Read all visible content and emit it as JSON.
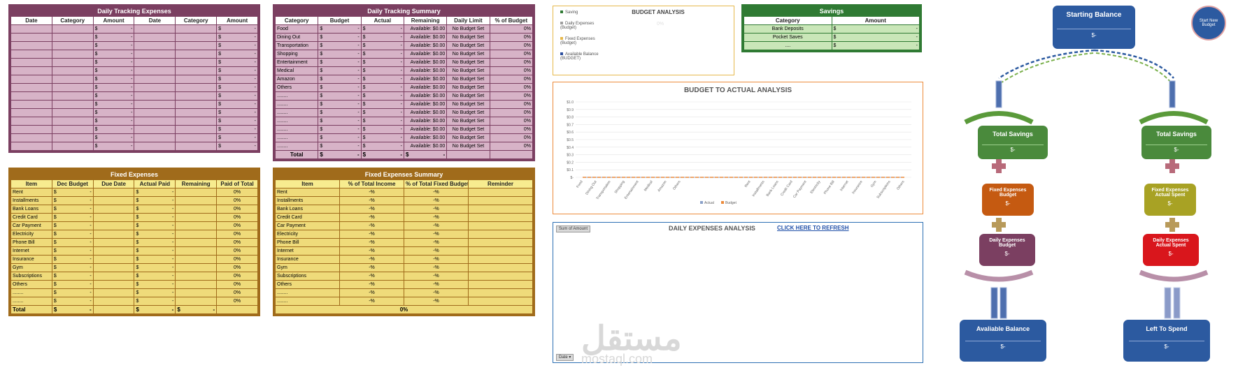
{
  "daily_tracking_expenses": {
    "title": "Daily Tracking Expenses",
    "headers": [
      "Date",
      "Category",
      "Amount",
      "Date",
      "Category",
      "Amount"
    ],
    "currency": "$",
    "dash": "-",
    "row_count": 15
  },
  "daily_tracking_summary": {
    "title": "Daily Tracking Summary",
    "headers": [
      "Category",
      "Budget",
      "Actual",
      "Remaining",
      "Daily Limit",
      "% of Budget"
    ],
    "rows": [
      "Food",
      "Dining Out",
      "Transportation",
      "Shopping",
      "Entertainment",
      "Medical",
      "Amazon",
      "Others",
      "........",
      "........",
      "........",
      "........",
      "........",
      "........",
      "........"
    ],
    "remaining_text": "Available: $0.00",
    "daily_limit_text": "No Budget Set",
    "pct_text": "0%",
    "total_label": "Total"
  },
  "fixed_expenses": {
    "title": "Fixed Expenses",
    "headers": [
      "Item",
      "Dec Budget",
      "Due Date",
      "Actual Paid",
      "Remaining",
      "Paid of Total"
    ],
    "rows": [
      "Rent",
      "Installments",
      "Bank Loans",
      "Credit Card",
      "Car Payment",
      "Electricity",
      "Phone Bill",
      "Internet",
      "Insurance",
      "Gym",
      "Subscriptions",
      "Others",
      "........",
      "........"
    ],
    "pct": "0%",
    "total_label": "Total"
  },
  "fixed_expenses_summary": {
    "title": "Fixed Expenses Summary",
    "headers": [
      "Item",
      "% of Total Income",
      "% of Total Fixed Budget",
      "Reminder"
    ],
    "rows": [
      "Rent",
      "Installments",
      "Bank Loans",
      "Credit Card",
      "Car Payment",
      "Electricity",
      "Phone Bill",
      "Internet",
      "Insurance",
      "Gym",
      "Subscriptions",
      "Others",
      "........",
      "........"
    ],
    "pct_placeholder": "-%",
    "total_pct": "0%"
  },
  "budget_analysis": {
    "title": "BUDGET ANALYSIS",
    "center_value": "0%",
    "legend": [
      {
        "label": "Saving",
        "color": "#2f7a33"
      },
      {
        "label": "Daily Expenses (Budget)",
        "color": "#9e9e9e"
      },
      {
        "label": "Fixed Expenses (Budget)",
        "color": "#e6b84a"
      },
      {
        "label": "Available Balance (BUDGET)",
        "color": "#2c4f9e"
      }
    ]
  },
  "savings": {
    "title": "Savings",
    "headers": [
      "Category",
      "Amount"
    ],
    "rows": [
      "Bank Deposits",
      "Pocket Saves",
      "...."
    ],
    "currency": "$",
    "dash": "-"
  },
  "chart_data": {
    "type": "line",
    "title": "BUDGET TO ACTUAL ANALYSIS",
    "y_ticks": [
      "$1.0",
      "$0.9",
      "$0.8",
      "$0.7",
      "$0.6",
      "$0.5",
      "$0.4",
      "$0.3",
      "$0.2",
      "$0.1",
      "$-"
    ],
    "ylim": [
      0,
      1
    ],
    "categories": [
      "Food",
      "Dining Out",
      "Transportation",
      "Shopping",
      "Entertainment",
      "Medical",
      "Amazon",
      "Others",
      "",
      "",
      "",
      "",
      "Rent",
      "Installments",
      "Bank Loans",
      "Credit Card",
      "Car Payment",
      "Electricity",
      "Phone Bill",
      "Internet",
      "Insurance",
      "Gym",
      "Subscriptions",
      "Others"
    ],
    "series": [
      {
        "name": "Actual",
        "color": "#8aa0c8",
        "values": [
          0,
          0,
          0,
          0,
          0,
          0,
          0,
          0,
          0,
          0,
          0,
          0,
          0,
          0,
          0,
          0,
          0,
          0,
          0,
          0,
          0,
          0,
          0,
          0
        ]
      },
      {
        "name": "Budget",
        "color": "#ec8a3a",
        "values": [
          0,
          0,
          0,
          0,
          0,
          0,
          0,
          0,
          0,
          0,
          0,
          0,
          0,
          0,
          0,
          0,
          0,
          0,
          0,
          0,
          0,
          0,
          0,
          0
        ]
      }
    ],
    "grid": true,
    "legend_position": "bottom"
  },
  "daily_expenses_analysis": {
    "title": "DAILY EXPENSES ANALYSIS",
    "refresh_link": "CLICK HERE TO REFRESH",
    "pivot_field": "Sum of Amount",
    "date_field": "Date"
  },
  "flow": {
    "start_button": "Start New Budget",
    "starting_balance": "Starting Balance",
    "total_savings": "Total Savings",
    "fixed_budget": "Fixed Expenses Budget",
    "fixed_actual": "Fixed Expenses Actual Spent",
    "daily_budget": "Daily Expenses Budget",
    "daily_actual": "Daily Expenses Actual Spent",
    "available_balance": "Avaliable Balance",
    "left_to_spend": "Left To Spend",
    "amount": "$-"
  },
  "watermark": {
    "arabic": "مستقل",
    "latin": "mostaql.com"
  }
}
